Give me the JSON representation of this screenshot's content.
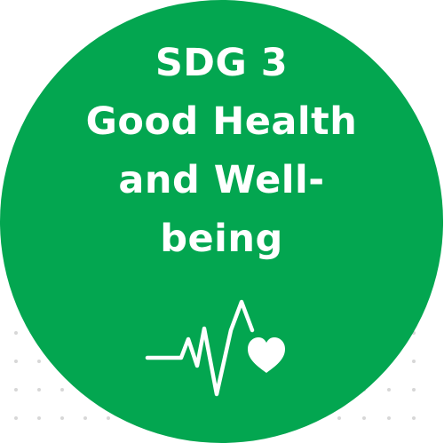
{
  "badge": {
    "code": "SDG 3",
    "title_lines": [
      "Good Health",
      "and Well-",
      "being"
    ],
    "background_color": "#03a650",
    "text_color": "#ffffff"
  },
  "icons": {
    "pulse": "heartbeat-line-icon",
    "heart": "heart-icon"
  },
  "decor": {
    "dot_color": "#d7d7d7"
  }
}
